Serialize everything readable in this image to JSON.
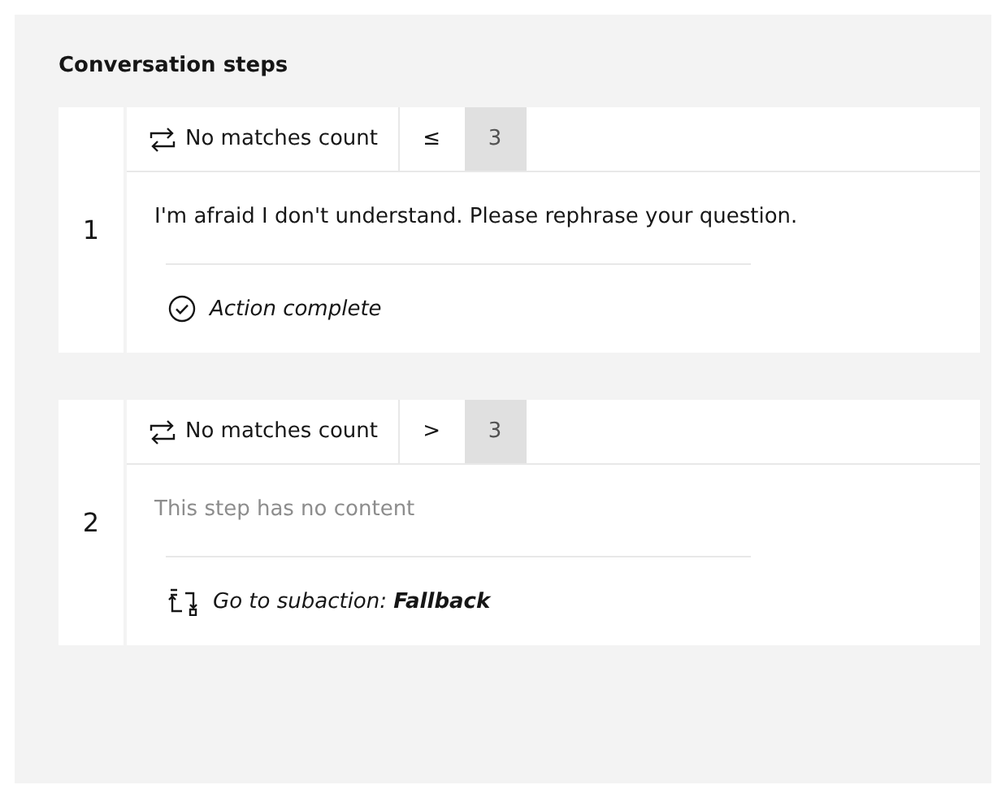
{
  "section_title": "Conversation steps",
  "steps": [
    {
      "number": "1",
      "condition": {
        "label": "No matches count",
        "operator": "≤",
        "value": "3"
      },
      "content": {
        "kind": "text",
        "text": "I'm afraid I don't understand. Please rephrase your question."
      },
      "end": {
        "kind": "complete",
        "text": "Action complete"
      }
    },
    {
      "number": "2",
      "condition": {
        "label": "No matches count",
        "operator": ">",
        "value": "3"
      },
      "content": {
        "kind": "empty",
        "text": "This step has no content"
      },
      "end": {
        "kind": "subaction",
        "text": "Go to subaction: **Fallback**"
      }
    }
  ]
}
